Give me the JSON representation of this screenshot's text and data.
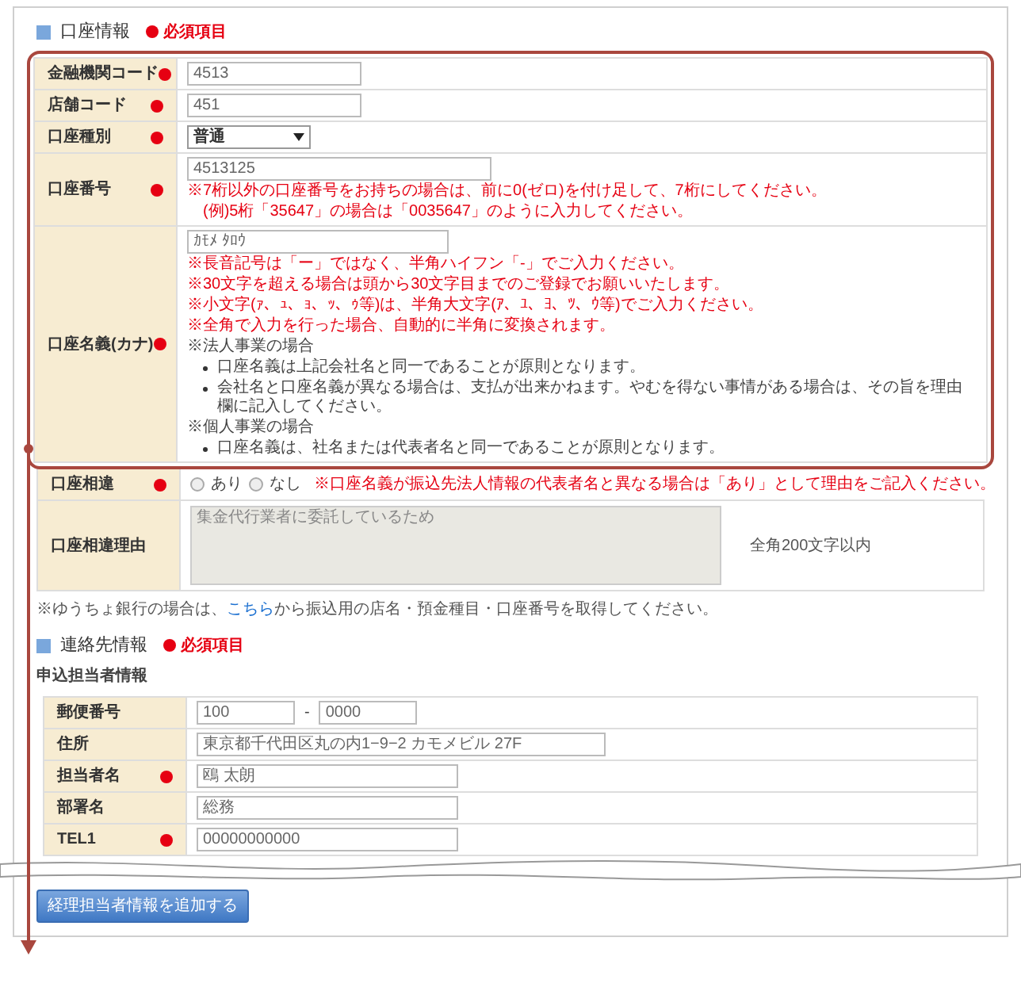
{
  "account_section": {
    "title": "口座情報",
    "required_legend": "必須項目",
    "rows": [
      {
        "kind": "short_input",
        "label": "金融機関コード",
        "required": true,
        "highlighted": true,
        "value": "4513"
      },
      {
        "kind": "short_input",
        "label": "店舗コード",
        "required": true,
        "highlighted": true,
        "value": "451"
      },
      {
        "kind": "select",
        "label": "口座種別",
        "required": true,
        "highlighted": true,
        "value": "普通"
      },
      {
        "kind": "long_input",
        "label": "口座番号",
        "required": true,
        "highlighted": true,
        "value": "4513125",
        "notes": [
          {
            "kind": "warning",
            "text": "※7桁以外の口座番号をお持ちの場合は、前に0(ゼロ)を付け足して、7桁にしてください。"
          },
          {
            "kind": "warning",
            "text": "　(例)5桁「35647」の場合は「0035647」のように入力してください。"
          }
        ]
      },
      {
        "kind": "medium_input",
        "label": "口座名義(カナ)",
        "required": true,
        "highlighted": true,
        "value": "ｶﾓﾒ ﾀﾛｳ",
        "notes": [
          {
            "kind": "warning",
            "text": "※長音記号は「ー」ではなく、半角ハイフン「-」でご入力ください。"
          },
          {
            "kind": "warning",
            "text": "※30文字を超える場合は頭から30文字目までのご登録でお願いいたします。"
          },
          {
            "kind": "warning",
            "text": "※小文字(ｧ、ｭ、ｮ、ｯ、ｩ等)は、半角大文字(ｱ、ﾕ、ﾖ、ﾂ、ｳ等)でご入力ください。"
          },
          {
            "kind": "warning",
            "text": "※全角で入力を行った場合、自動的に半角に変換されます。"
          },
          {
            "kind": "heading",
            "text": "※法人事業の場合"
          },
          {
            "kind": "bullet",
            "text": "口座名義は上記会社名と同一であることが原則となります。"
          },
          {
            "kind": "bullet",
            "text": "会社名と口座名義が異なる場合は、支払が出来かねます。やむを得ない事情がある場合は、その旨を理由欄に記入してください。"
          },
          {
            "kind": "heading",
            "text": "※個人事業の場合"
          },
          {
            "kind": "bullet",
            "text": "口座名義は、社名または代表者名と同一であることが原則となります。"
          }
        ]
      },
      {
        "kind": "radio",
        "label": "口座相違",
        "required": true,
        "highlighted": false,
        "options": [
          {
            "label": "あり",
            "selected": false
          },
          {
            "label": "なし",
            "selected": false
          }
        ],
        "warning": "※口座名義が振込先法人情報の代表者名と異なる場合は「あり」として理由をご記入ください。"
      },
      {
        "kind": "textarea",
        "label": "口座相違理由",
        "required": false,
        "highlighted": false,
        "disabled": true,
        "value": "集金代行業者に委託しているため",
        "hint": "全角200文字以内"
      }
    ],
    "note": {
      "before": "※ゆうちょ銀行の場合は、",
      "link": "こちら",
      "after": "から振込用の店名・預金種目・口座番号を取得してください。"
    }
  },
  "contact_section": {
    "title": "連絡先情報",
    "required_legend": "必須項目",
    "subheading": "申込担当者情報",
    "rows": [
      {
        "kind": "postal",
        "label": "郵便番号",
        "required": false,
        "values": [
          "100",
          "0000"
        ],
        "separator": "-"
      },
      {
        "kind": "wide_input",
        "label": "住所",
        "required": false,
        "value": "東京都千代田区丸の内1−9−2 カモメビル 27F"
      },
      {
        "kind": "medium_input",
        "label": "担当者名",
        "required": true,
        "value": "鴎 太朗"
      },
      {
        "kind": "medium_input",
        "label": "部署名",
        "required": false,
        "value": "総務"
      },
      {
        "kind": "medium_input",
        "label": "TEL1",
        "required": true,
        "value": "00000000000"
      }
    ],
    "add_button": "経理担当者情報を追加する"
  }
}
